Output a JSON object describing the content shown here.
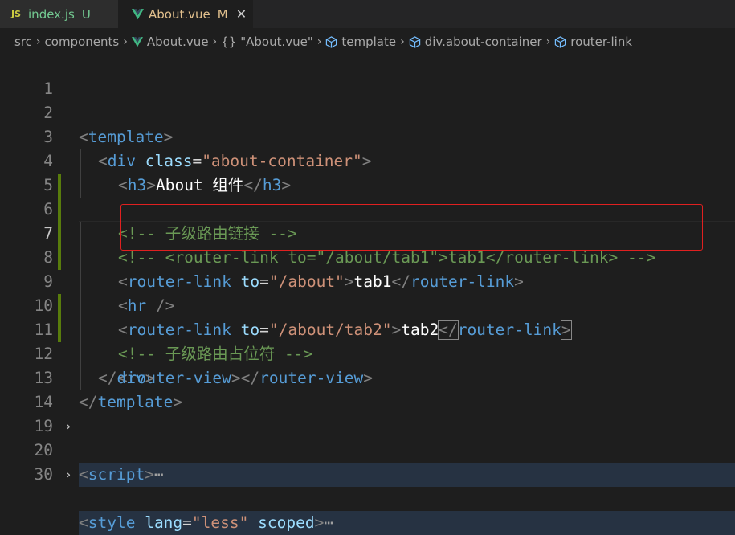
{
  "tabs": [
    {
      "icon": "JS",
      "label": "index.js",
      "status": "U"
    },
    {
      "label": "About.vue",
      "status": "M",
      "close": "✕"
    }
  ],
  "breadcrumb": {
    "items": [
      "src",
      "components",
      "About.vue",
      "\"About.vue\"",
      "template",
      "div.about-container",
      "router-link"
    ],
    "braces": "{}",
    "separator": "›"
  },
  "editor": {
    "line_numbers": [
      "1",
      "2",
      "3",
      "4",
      "5",
      "6",
      "7",
      "8",
      "9",
      "10",
      "11",
      "12",
      "13",
      "14",
      "19",
      "20",
      "30"
    ],
    "lines": {
      "l1": {
        "lt": "<",
        "tag": "template",
        "gt": ">"
      },
      "l2": {
        "lt": "<",
        "tag": "div",
        "attr": "class",
        "eq": "=",
        "val": "\"about-container\"",
        "gt": ">"
      },
      "l3": {
        "lt": "<",
        "tag": "h3",
        "gt": ">",
        "text": "About 组件",
        "clt": "</",
        "ctag": "h3",
        "cgt": ">"
      },
      "l4": {
        "comment": "<!-- 子级路由链接 -->"
      },
      "l5": {
        "comment": "<!-- <router-link to=\"/about/tab1\">tab1</router-link> -->"
      },
      "l6": {
        "lt": "<",
        "tag": "router-link",
        "attr": "to",
        "eq": "=",
        "val": "\"/about\"",
        "gt": ">",
        "text": "tab1",
        "clt": "</",
        "ctag": "router-link",
        "cgt": ">"
      },
      "l7": {
        "lt": "<",
        "tag": "router-link",
        "attr": "to",
        "eq": "=",
        "val": "\"/about/tab2\"",
        "gt": ">",
        "text": "tab2",
        "clt": "</",
        "ctag": "router-link",
        "cgt": ">"
      },
      "l8": {
        "lt": "<",
        "tag": "hr",
        "selfclose": " />"
      },
      "l9": {
        "comment": "<!-- 子级路由占位符 -->"
      },
      "l10": {
        "lt": "<",
        "tag": "router-view",
        "gt": ">",
        "clt": "</",
        "ctag": "router-view",
        "cgt": ">"
      },
      "l11": {
        "clt": "</",
        "ctag": "div",
        "cgt": ">"
      },
      "l12": {
        "clt": "</",
        "ctag": "template",
        "cgt": ">"
      },
      "l14": {
        "lt": "<",
        "tag": "script",
        "gt": ">",
        "ellipsis": "⋯"
      },
      "l20": {
        "lt": "<",
        "tag": "style",
        "attr": "lang",
        "eq": "=",
        "val": "\"less\"",
        "attr2": "scoped",
        "gt": ">",
        "ellipsis": "⋯"
      }
    },
    "fold_chevron": "›"
  },
  "colors": {
    "background": "#1e1e1e",
    "tag": "#569cd6",
    "attribute": "#9cdcfe",
    "string": "#ce9178",
    "comment": "#6a9955",
    "highlight_box": "#e02020",
    "modified_gutter": "#587c0c"
  }
}
